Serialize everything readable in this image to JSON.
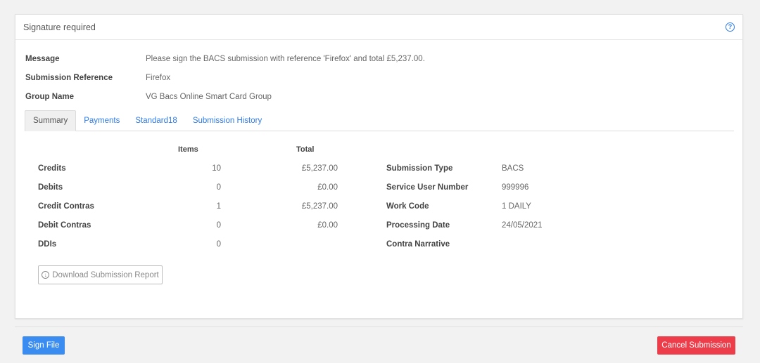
{
  "card": {
    "title": "Signature required",
    "help_icon": "?"
  },
  "details": [
    {
      "key": "Message",
      "value": "Please sign the BACS submission with reference 'Firefox' and total £5,237.00."
    },
    {
      "key": "Submission Reference",
      "value": "Firefox"
    },
    {
      "key": "Group Name",
      "value": "VG Bacs Online Smart Card Group"
    }
  ],
  "tabs": [
    {
      "label": "Summary",
      "active": true
    },
    {
      "label": "Payments",
      "active": false
    },
    {
      "label": "Standard18",
      "active": false
    },
    {
      "label": "Submission History",
      "active": false
    }
  ],
  "summary": {
    "headers": {
      "items": "Items",
      "total": "Total"
    },
    "rows": [
      {
        "label": "Credits",
        "items": "10",
        "total": "£5,237.00"
      },
      {
        "label": "Debits",
        "items": "0",
        "total": "£0.00"
      },
      {
        "label": "Credit Contras",
        "items": "1",
        "total": "£5,237.00"
      },
      {
        "label": "Debit Contras",
        "items": "0",
        "total": "£0.00"
      },
      {
        "label": "DDIs",
        "items": "0",
        "total": ""
      }
    ],
    "info": [
      {
        "label": "Submission Type",
        "value": "BACS"
      },
      {
        "label": "Service User Number",
        "value": "999996"
      },
      {
        "label": "Work Code",
        "value": "1 DAILY"
      },
      {
        "label": "Processing Date",
        "value": "24/05/2021"
      },
      {
        "label": "Contra Narrative",
        "value": ""
      }
    ],
    "download_label": "Download Submission Report",
    "download_icon": "download-circle-icon"
  },
  "footer": {
    "sign_label": "Sign File",
    "cancel_label": "Cancel Submission"
  },
  "colors": {
    "link": "#2f7be5",
    "primary": "#3b8cf0",
    "danger": "#ee3d4a"
  }
}
